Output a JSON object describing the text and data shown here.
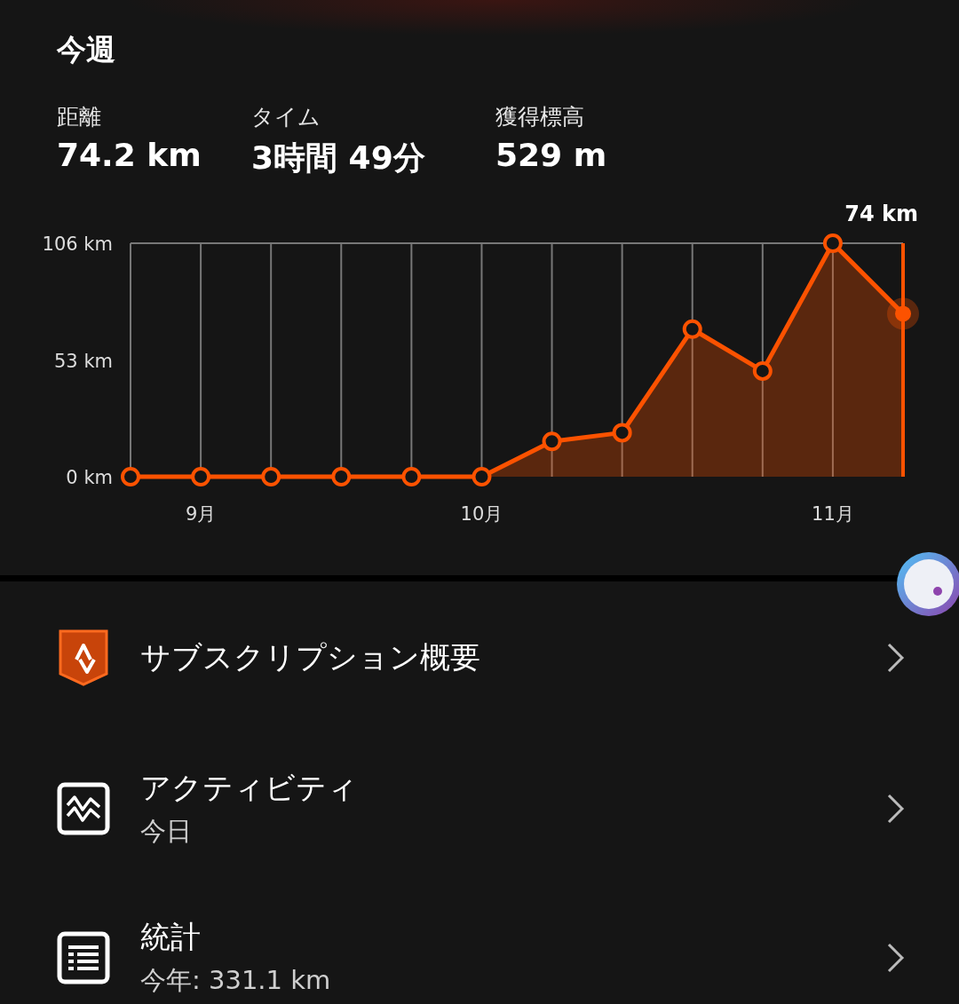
{
  "section_title": "今週",
  "stats": [
    {
      "label": "距離",
      "value": "74.2 km"
    },
    {
      "label": "タイム",
      "value": "3時間 49分"
    },
    {
      "label": "獲得標高",
      "value": "529 m"
    }
  ],
  "chart_data": {
    "type": "area",
    "categories": [
      null,
      "9月",
      null,
      null,
      null,
      "10月",
      null,
      null,
      null,
      null,
      "11月",
      null
    ],
    "series": [
      {
        "color": "#fc5200",
        "values": [
          0,
          0,
          0,
          0,
          0,
          0,
          16,
          20,
          67,
          48,
          106,
          74
        ]
      }
    ],
    "ylim": [
      0,
      106
    ],
    "yticks": [
      {
        "value": 0,
        "label": "0 km"
      },
      {
        "value": 53,
        "label": "53 km"
      },
      {
        "value": 106,
        "label": "106 km"
      }
    ],
    "grid": true,
    "annotations": [
      "74 km"
    ]
  },
  "menu": [
    {
      "kind": "subscription",
      "title": "サブスクリプション概要"
    },
    {
      "kind": "activity",
      "title": "アクティビティ",
      "subtitle": "今日"
    },
    {
      "kind": "stats",
      "title": "統計",
      "subtitle": "今年: 331.1 km"
    }
  ]
}
